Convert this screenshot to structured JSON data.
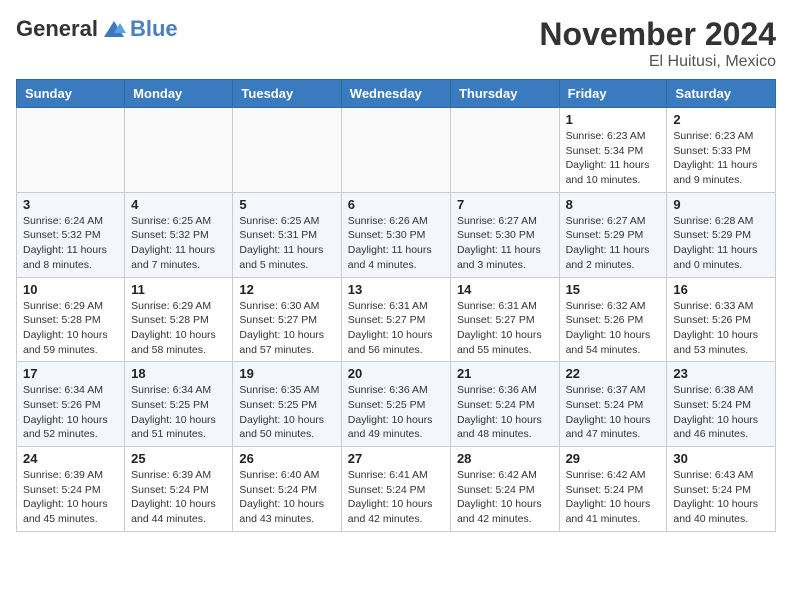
{
  "logo": {
    "general": "General",
    "blue": "Blue"
  },
  "title": "November 2024",
  "location": "El Huitusi, Mexico",
  "days_header": [
    "Sunday",
    "Monday",
    "Tuesday",
    "Wednesday",
    "Thursday",
    "Friday",
    "Saturday"
  ],
  "weeks": [
    [
      {
        "day": "",
        "info": ""
      },
      {
        "day": "",
        "info": ""
      },
      {
        "day": "",
        "info": ""
      },
      {
        "day": "",
        "info": ""
      },
      {
        "day": "",
        "info": ""
      },
      {
        "day": "1",
        "info": "Sunrise: 6:23 AM\nSunset: 5:34 PM\nDaylight: 11 hours and 10 minutes."
      },
      {
        "day": "2",
        "info": "Sunrise: 6:23 AM\nSunset: 5:33 PM\nDaylight: 11 hours and 9 minutes."
      }
    ],
    [
      {
        "day": "3",
        "info": "Sunrise: 6:24 AM\nSunset: 5:32 PM\nDaylight: 11 hours and 8 minutes."
      },
      {
        "day": "4",
        "info": "Sunrise: 6:25 AM\nSunset: 5:32 PM\nDaylight: 11 hours and 7 minutes."
      },
      {
        "day": "5",
        "info": "Sunrise: 6:25 AM\nSunset: 5:31 PM\nDaylight: 11 hours and 5 minutes."
      },
      {
        "day": "6",
        "info": "Sunrise: 6:26 AM\nSunset: 5:30 PM\nDaylight: 11 hours and 4 minutes."
      },
      {
        "day": "7",
        "info": "Sunrise: 6:27 AM\nSunset: 5:30 PM\nDaylight: 11 hours and 3 minutes."
      },
      {
        "day": "8",
        "info": "Sunrise: 6:27 AM\nSunset: 5:29 PM\nDaylight: 11 hours and 2 minutes."
      },
      {
        "day": "9",
        "info": "Sunrise: 6:28 AM\nSunset: 5:29 PM\nDaylight: 11 hours and 0 minutes."
      }
    ],
    [
      {
        "day": "10",
        "info": "Sunrise: 6:29 AM\nSunset: 5:28 PM\nDaylight: 10 hours and 59 minutes."
      },
      {
        "day": "11",
        "info": "Sunrise: 6:29 AM\nSunset: 5:28 PM\nDaylight: 10 hours and 58 minutes."
      },
      {
        "day": "12",
        "info": "Sunrise: 6:30 AM\nSunset: 5:27 PM\nDaylight: 10 hours and 57 minutes."
      },
      {
        "day": "13",
        "info": "Sunrise: 6:31 AM\nSunset: 5:27 PM\nDaylight: 10 hours and 56 minutes."
      },
      {
        "day": "14",
        "info": "Sunrise: 6:31 AM\nSunset: 5:27 PM\nDaylight: 10 hours and 55 minutes."
      },
      {
        "day": "15",
        "info": "Sunrise: 6:32 AM\nSunset: 5:26 PM\nDaylight: 10 hours and 54 minutes."
      },
      {
        "day": "16",
        "info": "Sunrise: 6:33 AM\nSunset: 5:26 PM\nDaylight: 10 hours and 53 minutes."
      }
    ],
    [
      {
        "day": "17",
        "info": "Sunrise: 6:34 AM\nSunset: 5:26 PM\nDaylight: 10 hours and 52 minutes."
      },
      {
        "day": "18",
        "info": "Sunrise: 6:34 AM\nSunset: 5:25 PM\nDaylight: 10 hours and 51 minutes."
      },
      {
        "day": "19",
        "info": "Sunrise: 6:35 AM\nSunset: 5:25 PM\nDaylight: 10 hours and 50 minutes."
      },
      {
        "day": "20",
        "info": "Sunrise: 6:36 AM\nSunset: 5:25 PM\nDaylight: 10 hours and 49 minutes."
      },
      {
        "day": "21",
        "info": "Sunrise: 6:36 AM\nSunset: 5:24 PM\nDaylight: 10 hours and 48 minutes."
      },
      {
        "day": "22",
        "info": "Sunrise: 6:37 AM\nSunset: 5:24 PM\nDaylight: 10 hours and 47 minutes."
      },
      {
        "day": "23",
        "info": "Sunrise: 6:38 AM\nSunset: 5:24 PM\nDaylight: 10 hours and 46 minutes."
      }
    ],
    [
      {
        "day": "24",
        "info": "Sunrise: 6:39 AM\nSunset: 5:24 PM\nDaylight: 10 hours and 45 minutes."
      },
      {
        "day": "25",
        "info": "Sunrise: 6:39 AM\nSunset: 5:24 PM\nDaylight: 10 hours and 44 minutes."
      },
      {
        "day": "26",
        "info": "Sunrise: 6:40 AM\nSunset: 5:24 PM\nDaylight: 10 hours and 43 minutes."
      },
      {
        "day": "27",
        "info": "Sunrise: 6:41 AM\nSunset: 5:24 PM\nDaylight: 10 hours and 42 minutes."
      },
      {
        "day": "28",
        "info": "Sunrise: 6:42 AM\nSunset: 5:24 PM\nDaylight: 10 hours and 42 minutes."
      },
      {
        "day": "29",
        "info": "Sunrise: 6:42 AM\nSunset: 5:24 PM\nDaylight: 10 hours and 41 minutes."
      },
      {
        "day": "30",
        "info": "Sunrise: 6:43 AM\nSunset: 5:24 PM\nDaylight: 10 hours and 40 minutes."
      }
    ]
  ]
}
